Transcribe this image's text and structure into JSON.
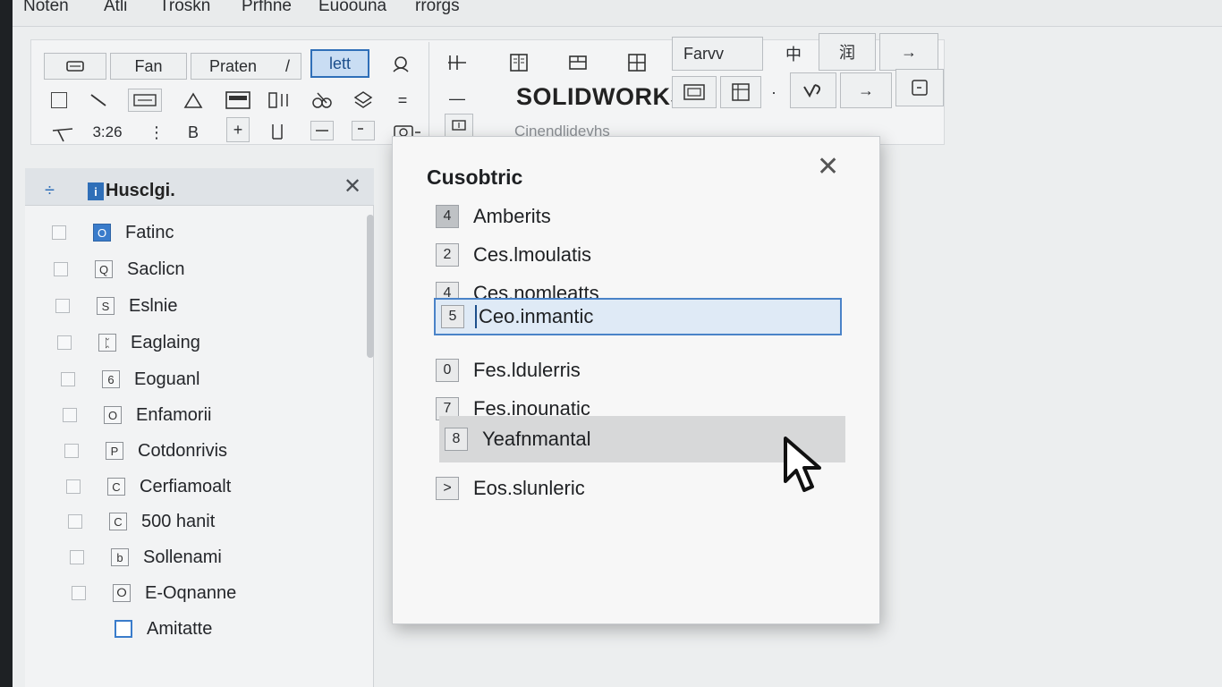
{
  "menu": [
    "Noten",
    "Atli",
    "Troskn",
    "Prfhne",
    "Euoouna",
    "rrorgs"
  ],
  "ribbon": {
    "btn_fan": "Fan",
    "btn_praten": "Praten",
    "btn_lett": "lett",
    "btn_b": "B",
    "field_value": "3:26",
    "btn_favv": "Farvv",
    "logo": "SOLIDWORKS",
    "logo_sub": "Cinendlidevhs",
    "glyph_zhong": "中",
    "glyph_run": "润"
  },
  "left_panel": {
    "title": "Husclgi.",
    "items": [
      {
        "icon": "O",
        "label": "Fatinc"
      },
      {
        "icon": "Q",
        "label": "Saclicn"
      },
      {
        "icon": "S",
        "label": "Eslnie"
      },
      {
        "icon": "ᛈ",
        "label": "Eaglaing"
      },
      {
        "icon": "6",
        "label": "Eoguanl"
      },
      {
        "icon": "O",
        "label": "Enfamorii"
      },
      {
        "icon": "P",
        "label": "Cotdonrivis"
      },
      {
        "icon": "C",
        "label": "Cerfiamoalt"
      },
      {
        "icon": "C",
        "label": "500 hanit"
      },
      {
        "icon": "b",
        "label": "Sollenami"
      },
      {
        "icon": "ⵔ",
        "label": "E-Oqnanne"
      },
      {
        "icon": "",
        "label": "Amitatte"
      }
    ]
  },
  "dialog": {
    "title": "Cusobtric",
    "items": [
      {
        "num": "4",
        "label": "Amberits"
      },
      {
        "num": "2",
        "label": "Ces.lmoulatis"
      },
      {
        "num": "4",
        "label": "Ces.nomleatts"
      },
      {
        "num": "5",
        "label": "Ceo.inmantic"
      },
      {
        "num": "0",
        "label": "Fes.ldulerris"
      },
      {
        "num": "7",
        "label": "Fes.inounatic"
      },
      {
        "num": "8",
        "label": "Yeafnmantal"
      },
      {
        "num": ">",
        "label": "Eos.slunleric"
      }
    ]
  },
  "colors": {
    "accent": "#2f6fb8",
    "selection_fill": "#dfeaf6",
    "hover_fill": "#d7d8d9"
  }
}
